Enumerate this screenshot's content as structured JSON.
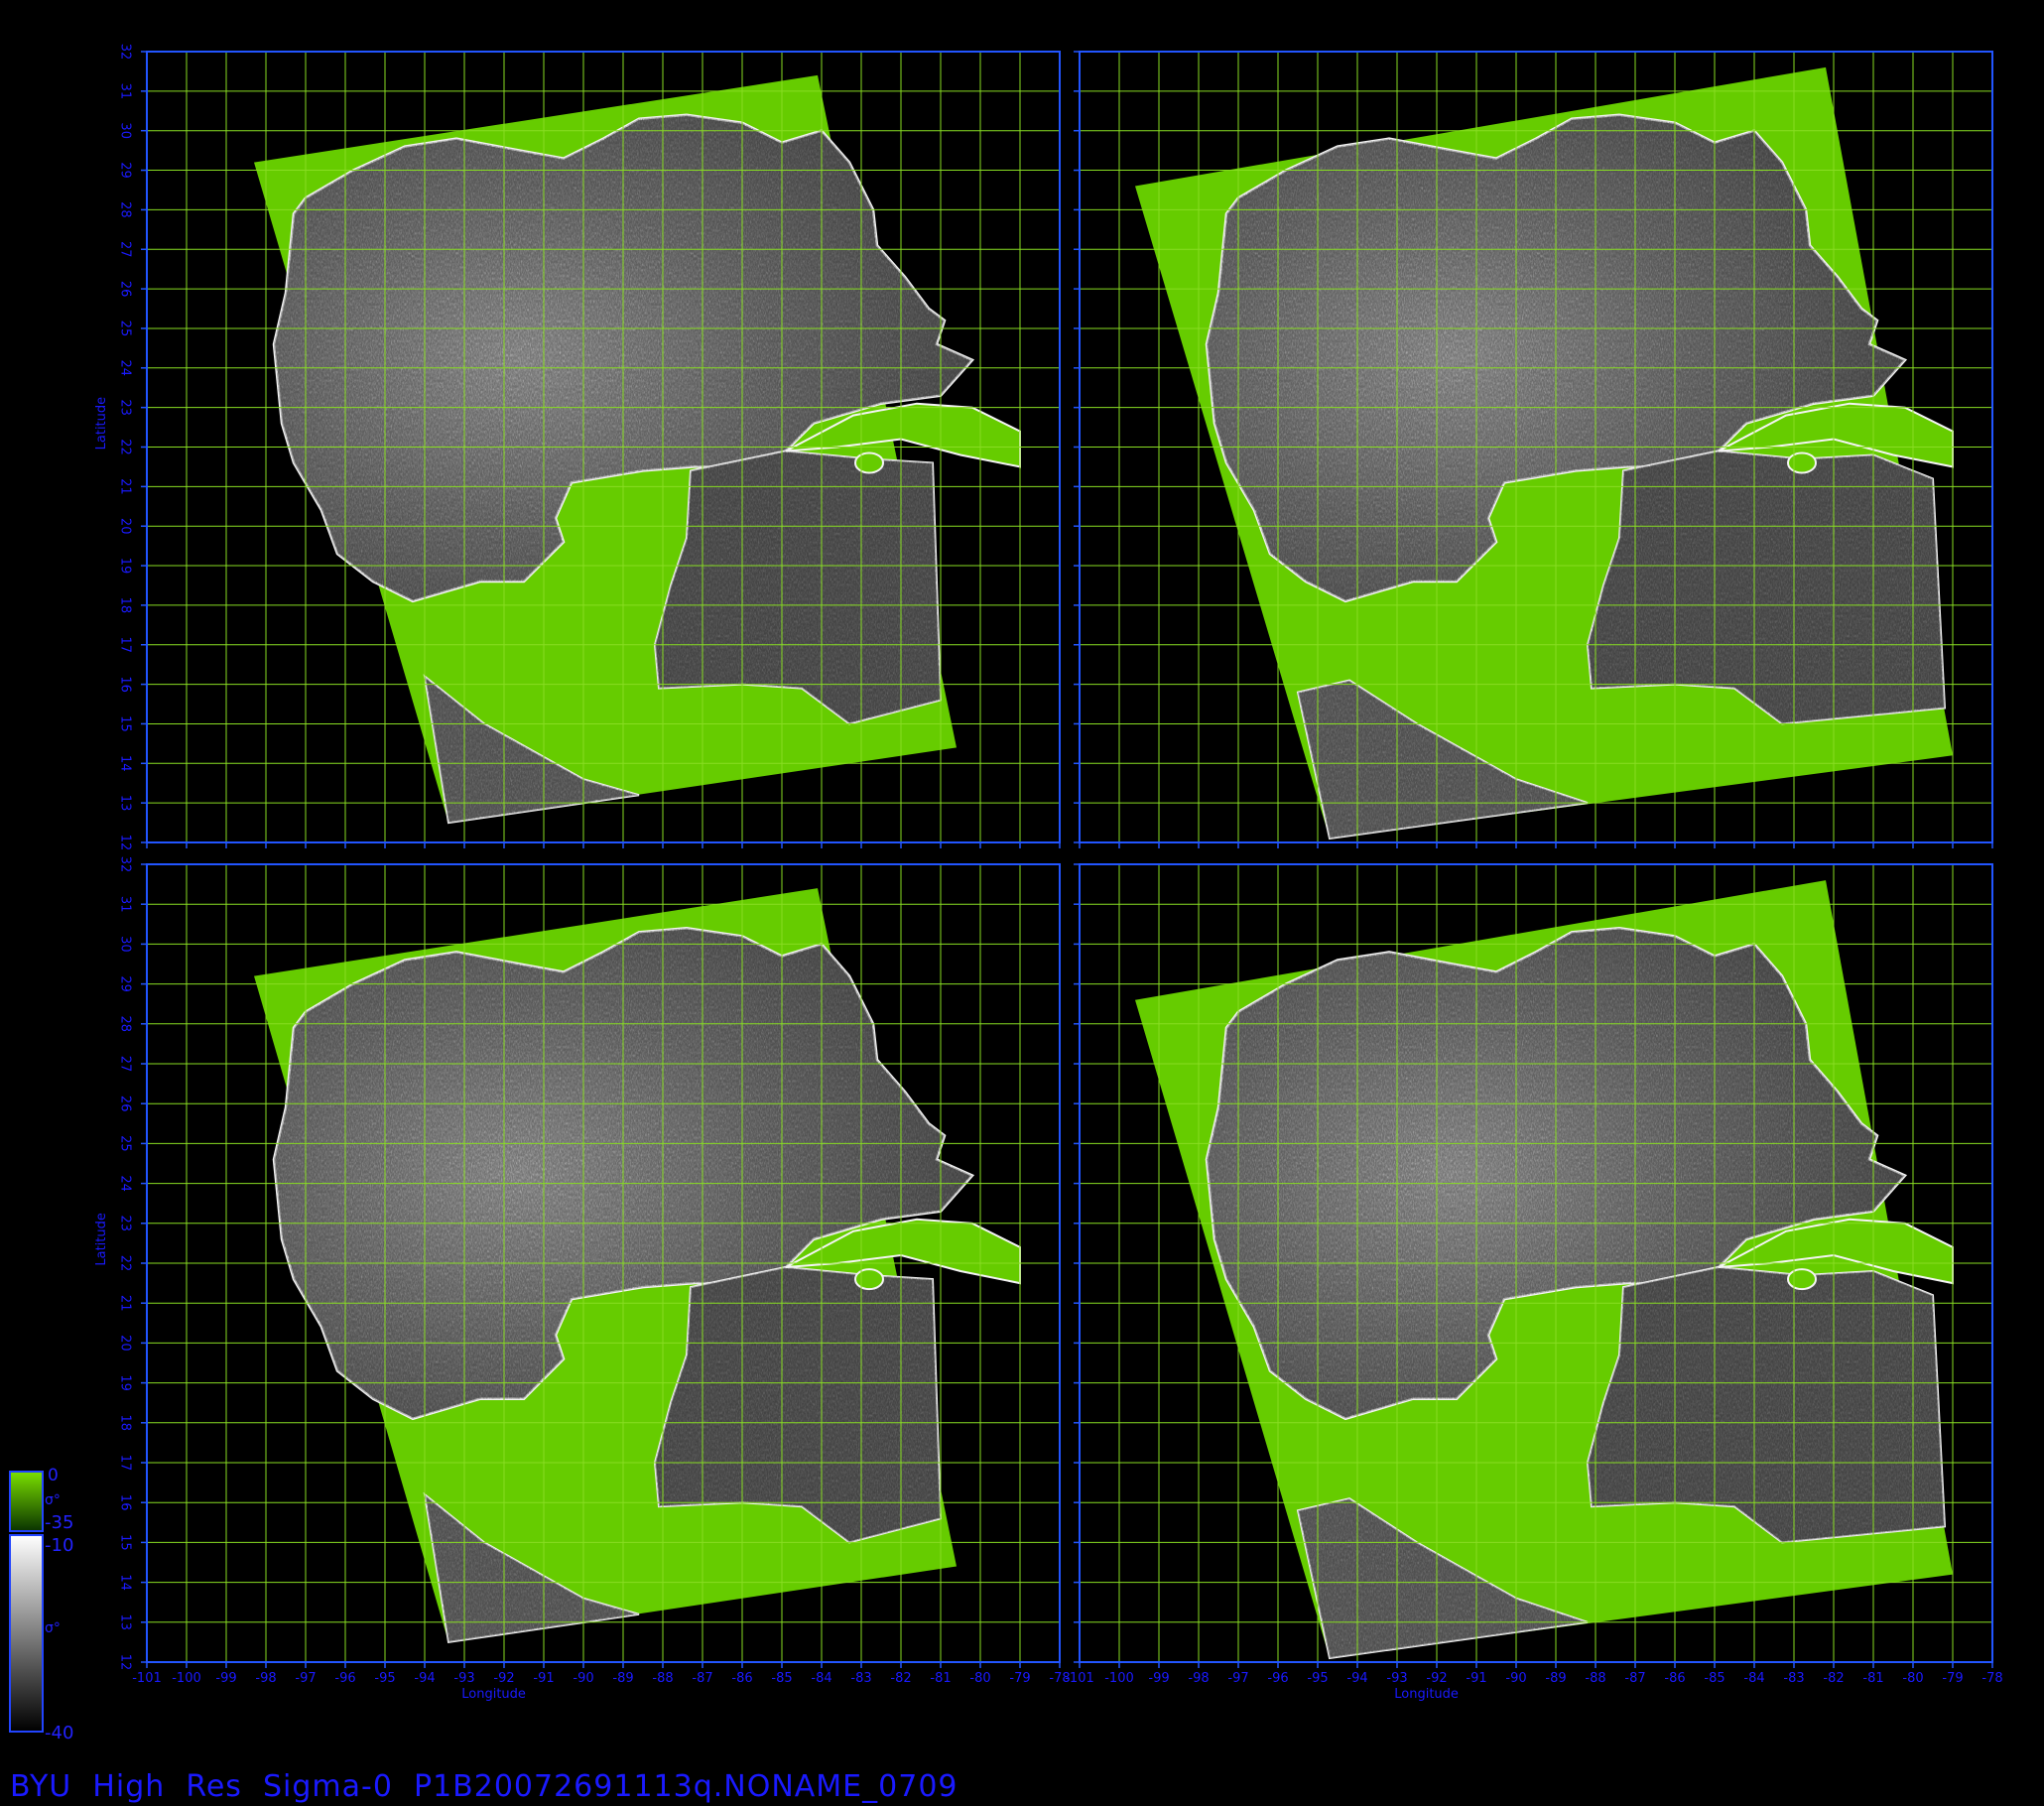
{
  "caption": "BYU  High  Res  Sigma-0  P1B20072691113q.NONAME_0709",
  "axes": {
    "xlabel": "Longitude",
    "ylabel": "Latitude",
    "lon_ticks": [
      "-101",
      "-100",
      "-99",
      "-98",
      "-97",
      "-96",
      "-95",
      "-94",
      "-93",
      "-92",
      "-91",
      "-90",
      "-89",
      "-88",
      "-87",
      "-86",
      "-85",
      "-84",
      "-83",
      "-82",
      "-81",
      "-80",
      "-79",
      "-78"
    ],
    "lat_ticks": [
      "12",
      "13",
      "14",
      "15",
      "16",
      "17",
      "18",
      "19",
      "20",
      "21",
      "22",
      "23",
      "24",
      "25",
      "26",
      "27",
      "28",
      "29",
      "30",
      "31",
      "32"
    ],
    "lon_range": [
      -101,
      -78
    ],
    "lat_range": [
      12,
      32
    ]
  },
  "colorbar": {
    "land_top": "0",
    "land_bottom": "-35",
    "sea_top": "-10",
    "sea_bottom": "-40",
    "symbol": "σ°"
  },
  "colors": {
    "land": "#66cc00",
    "grid": "#88dd22",
    "frame": "#2255ff",
    "text": "#1a1aff"
  },
  "panels": [
    {
      "id": "top-left",
      "swath_shape": "narrow"
    },
    {
      "id": "top-right",
      "swath_shape": "wide"
    },
    {
      "id": "bottom-left",
      "swath_shape": "narrow"
    },
    {
      "id": "bottom-right",
      "swath_shape": "wide"
    }
  ]
}
